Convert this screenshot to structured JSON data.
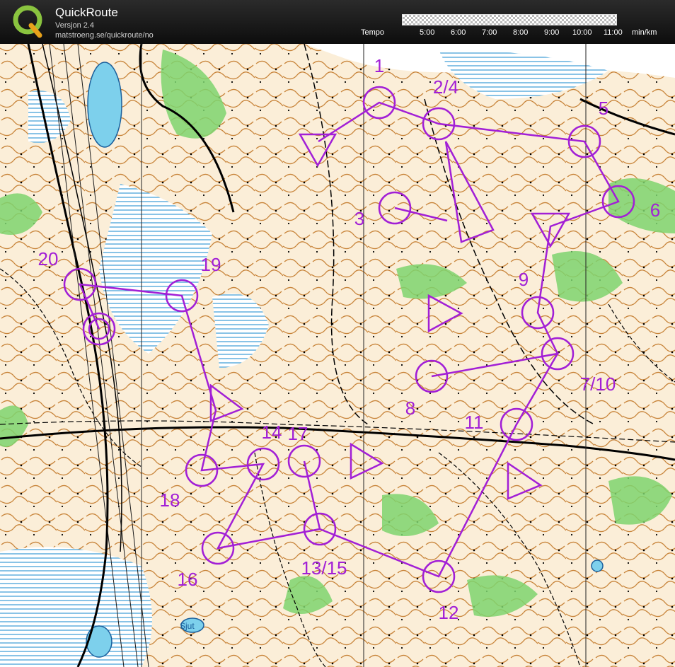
{
  "header": {
    "title": "QuickRoute",
    "version": "Versjon 2.4",
    "url": "matstroeng.se/quickroute/no",
    "tempo_label": "Tempo",
    "tempo_ticks": [
      "5:00",
      "6:00",
      "7:00",
      "8:00",
      "9:00",
      "10:00",
      "11:00"
    ],
    "tempo_unit": "min/km"
  },
  "map": {
    "course_color": "#a21fd6",
    "controls": [
      {
        "label": "1"
      },
      {
        "label": "2/4"
      },
      {
        "label": "3"
      },
      {
        "label": "5"
      },
      {
        "label": "6"
      },
      {
        "label": "9"
      },
      {
        "label": "7/10"
      },
      {
        "label": "8"
      },
      {
        "label": "11"
      },
      {
        "label": "12"
      },
      {
        "label": "13/15"
      },
      {
        "label": "14"
      },
      {
        "label": "17"
      },
      {
        "label": "16"
      },
      {
        "label": "18"
      },
      {
        "label": "19"
      },
      {
        "label": "20"
      }
    ],
    "lake_label": "Sjut"
  }
}
